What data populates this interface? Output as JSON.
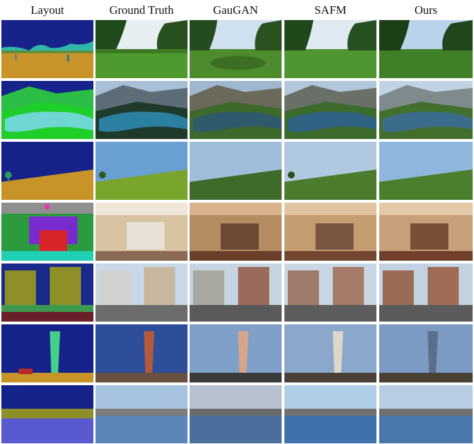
{
  "header": {
    "columns": [
      "Layout",
      "Ground Truth",
      "GauGAN",
      "SAFM",
      "Ours"
    ]
  },
  "rows": [
    {
      "scene": "park-with-trees"
    },
    {
      "scene": "mountain-lake"
    },
    {
      "scene": "grassy-hill-sky"
    },
    {
      "scene": "bedroom-interior"
    },
    {
      "scene": "houses-street"
    },
    {
      "scene": "tower-city"
    },
    {
      "scene": "harbor-skyline"
    }
  ]
}
